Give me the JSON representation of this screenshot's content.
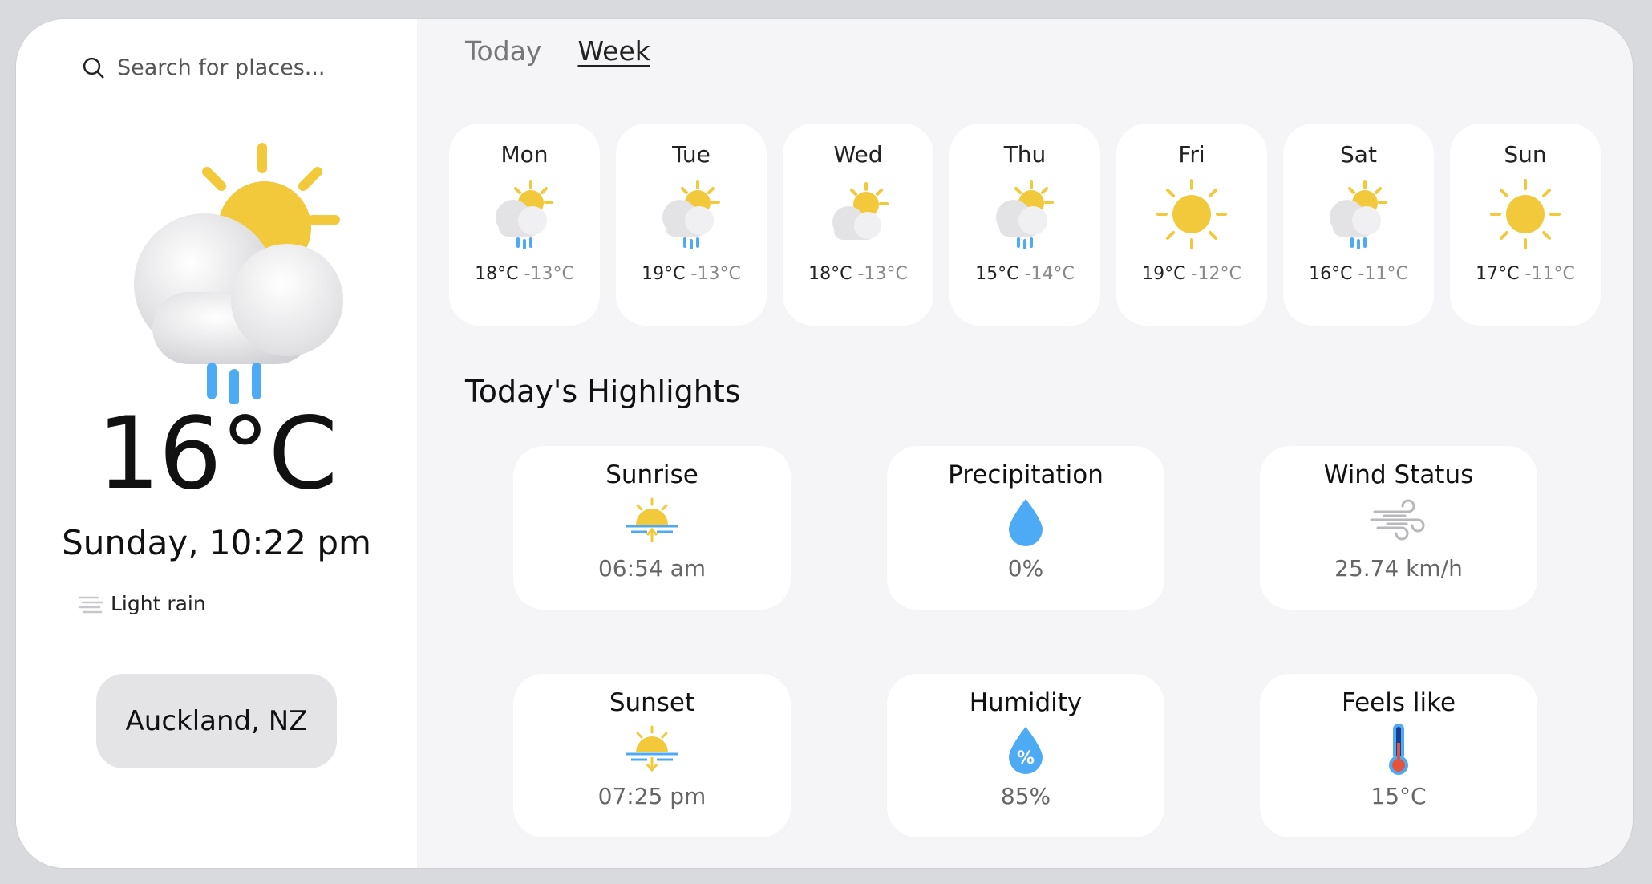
{
  "search": {
    "placeholder": "Search for places...",
    "icon": "search-icon"
  },
  "current": {
    "temperature": "16°C",
    "datetime": "Sunday, 10:22 pm",
    "condition": "Light rain",
    "location": "Auckland, NZ",
    "icon": "partly-cloudy-rain-icon"
  },
  "tabs": [
    {
      "label": "Today",
      "active": false
    },
    {
      "label": "Week",
      "active": true
    }
  ],
  "week": [
    {
      "day": "Mon",
      "high": "18°C",
      "low": "-13°C",
      "icon": "partly-cloudy-rain-icon"
    },
    {
      "day": "Tue",
      "high": "19°C",
      "low": "-13°C",
      "icon": "partly-cloudy-rain-icon"
    },
    {
      "day": "Wed",
      "high": "18°C",
      "low": "-13°C",
      "icon": "partly-cloudy-icon"
    },
    {
      "day": "Thu",
      "high": "15°C",
      "low": "-14°C",
      "icon": "partly-cloudy-rain-icon"
    },
    {
      "day": "Fri",
      "high": "19°C",
      "low": "-12°C",
      "icon": "sun-icon"
    },
    {
      "day": "Sat",
      "high": "16°C",
      "low": "-11°C",
      "icon": "partly-cloudy-rain-icon"
    },
    {
      "day": "Sun",
      "high": "17°C",
      "low": "-11°C",
      "icon": "sun-icon"
    }
  ],
  "highlights": {
    "title": "Today's Highlights",
    "items": [
      {
        "title": "Sunrise",
        "value": "06:54 am",
        "icon": "sunrise-icon"
      },
      {
        "title": "Precipitation",
        "value": "0%",
        "icon": "raindrop-icon"
      },
      {
        "title": "Wind Status",
        "value": "25.74 km/h",
        "icon": "wind-icon"
      },
      {
        "title": "Sunset",
        "value": "07:25 pm",
        "icon": "sunset-icon"
      },
      {
        "title": "Humidity",
        "value": "85%",
        "icon": "humidity-icon"
      },
      {
        "title": "Feels like",
        "value": "15°C",
        "icon": "thermometer-icon"
      }
    ],
    "humidity_glyph": "%"
  },
  "colors": {
    "sun": "#F1C93B",
    "rain": "#4DAAF5",
    "cloud": "#E9E9EB",
    "panel": "#F5F5F7"
  }
}
